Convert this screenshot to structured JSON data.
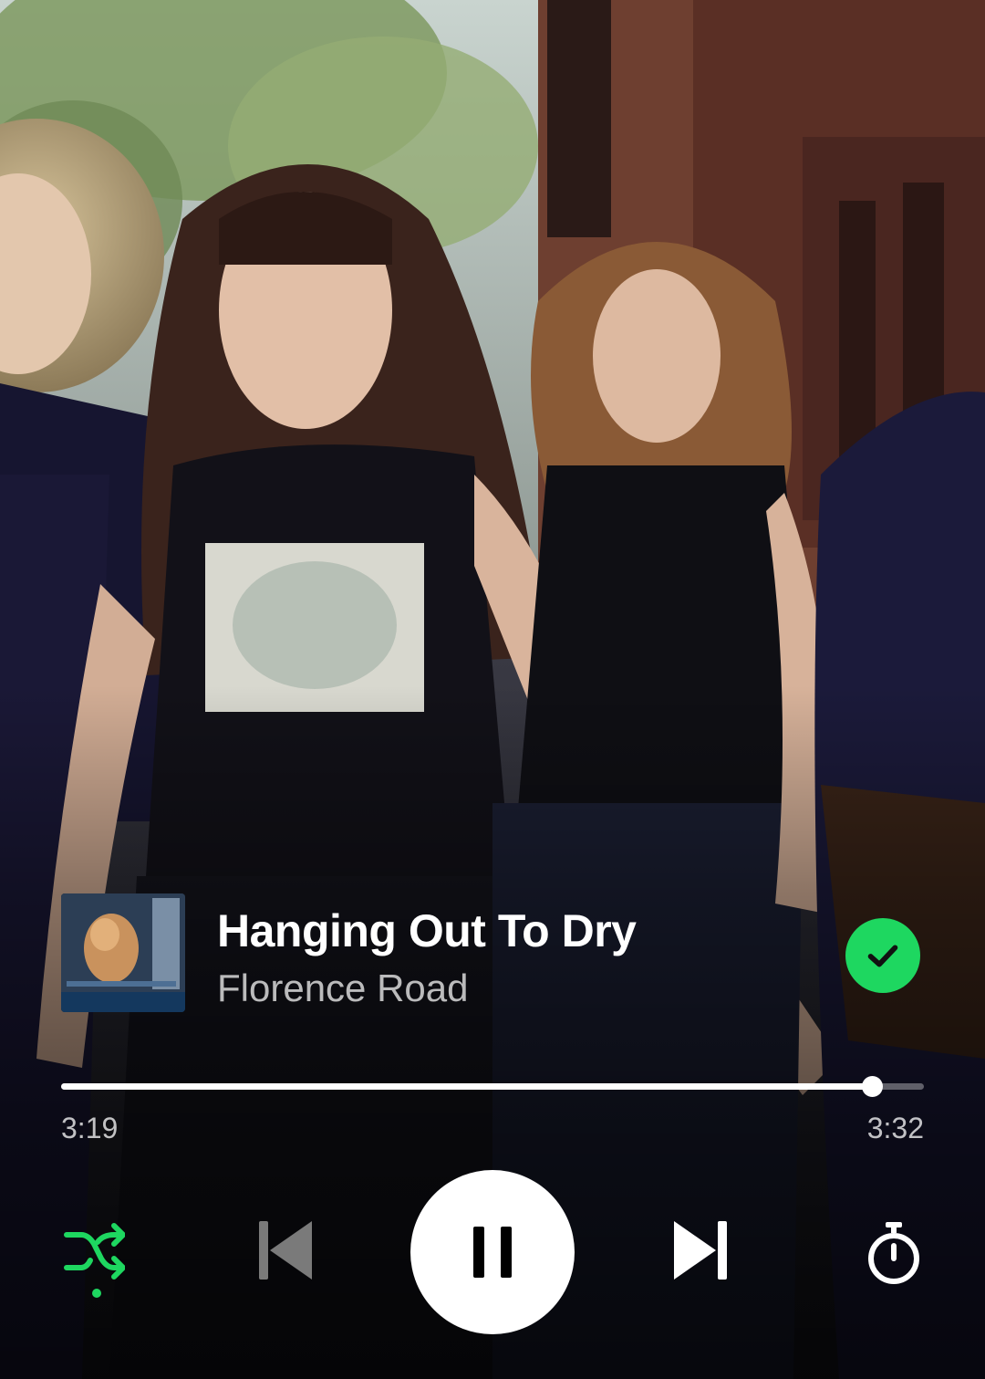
{
  "track": {
    "title": "Hanging Out To Dry",
    "artist": "Florence Road",
    "liked": true
  },
  "playback": {
    "elapsed": "3:19",
    "total": "3:32",
    "progress_fraction": 0.94,
    "is_playing": true,
    "shuffle_enabled": true
  },
  "icons": {
    "liked": "check-circle-icon",
    "shuffle": "shuffle-icon",
    "previous": "skip-previous-icon",
    "play_pause": "pause-icon",
    "next": "skip-next-icon",
    "timer": "sleep-timer-icon"
  },
  "colors": {
    "accent": "#1ed760",
    "text_primary": "#ffffff",
    "text_secondary": "#b8b8b8",
    "disabled": "#7a7a7a"
  }
}
